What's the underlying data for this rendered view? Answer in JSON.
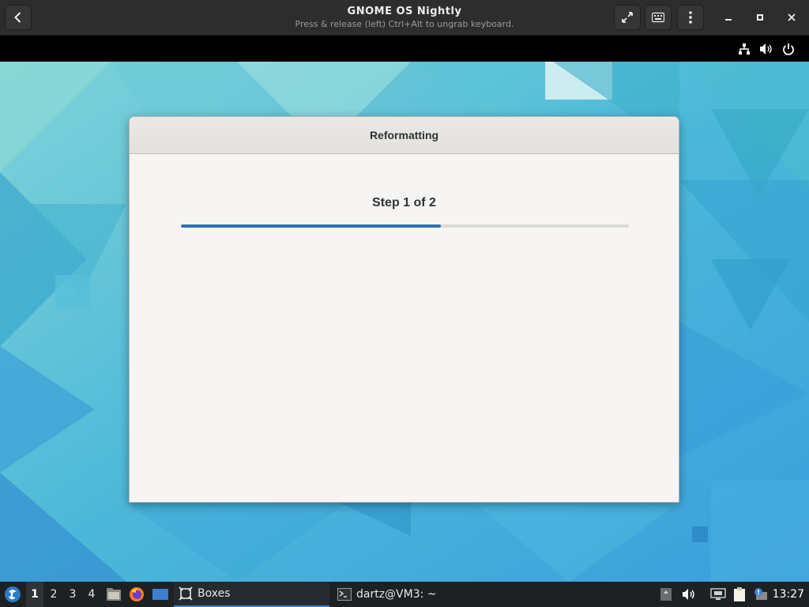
{
  "window": {
    "title": "GNOME OS Nightly",
    "subtitle": "Press & release (left) Ctrl+Alt to ungrab keyboard."
  },
  "icons": {
    "back": "back-arrow-icon",
    "fullscreen": "fullscreen-icon",
    "keyboard": "keyboard-icon",
    "menu": "kebab-menu-icon",
    "minimize": "minimize-icon",
    "maximize": "maximize-icon",
    "close": "close-icon",
    "network": "network-icon",
    "volume": "volume-icon",
    "power": "power-icon"
  },
  "dialog": {
    "title": "Reformatting",
    "step_label": "Step 1 of 2",
    "progress": 0.58
  },
  "taskbar": {
    "workspaces": [
      "1",
      "2",
      "3",
      "4"
    ],
    "active_workspace": "1",
    "tasks": [
      {
        "label": "Boxes",
        "active": true
      },
      {
        "label": "dartz@VM3: ~",
        "active": false
      }
    ],
    "clock": "13:27"
  },
  "colors": {
    "accent": "#2f6fb8",
    "desktop": "#4fb6d6",
    "header": "#2d2d2d"
  }
}
